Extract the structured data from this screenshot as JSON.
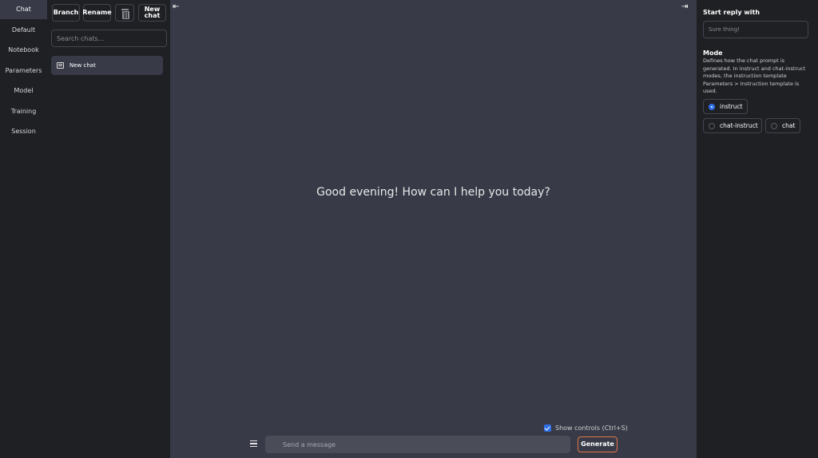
{
  "tabs": {
    "items": [
      {
        "label": "Chat",
        "active": true
      },
      {
        "label": "Default",
        "active": false
      },
      {
        "label": "Notebook",
        "active": false
      },
      {
        "label": "Parameters",
        "active": false
      },
      {
        "label": "Model",
        "active": false
      },
      {
        "label": "Training",
        "active": false
      },
      {
        "label": "Session",
        "active": false
      }
    ]
  },
  "history": {
    "branch_label": "Branch",
    "rename_label": "Rename",
    "delete_icon": "trash-icon",
    "new_chat_line1": "New",
    "new_chat_line2": "chat",
    "search_placeholder": "Search chats...",
    "chats": [
      {
        "label": "New chat",
        "icon": "chat-bubble-icon"
      }
    ]
  },
  "main": {
    "greeting": "Good evening! How can I help you today?",
    "show_controls_label": "Show controls (Ctrl+S)",
    "show_controls_checked": true,
    "message_placeholder": "Send a message",
    "generate_label": "Generate"
  },
  "right_panel": {
    "start_reply_label": "Start reply with",
    "start_reply_placeholder": "Sure thing!",
    "mode_label": "Mode",
    "mode_description": "Defines how the chat prompt is generated. In instruct and chat-instruct modes, the instruction template Parameters > Instruction template is used.",
    "modes": [
      {
        "label": "instruct",
        "selected": true
      },
      {
        "label": "chat-instruct",
        "selected": false
      },
      {
        "label": "chat",
        "selected": false
      }
    ]
  },
  "colors": {
    "accent": "#2f6fe6",
    "generate_border": "#e0784a",
    "background": "#383a47",
    "panel": "#1f2024"
  }
}
